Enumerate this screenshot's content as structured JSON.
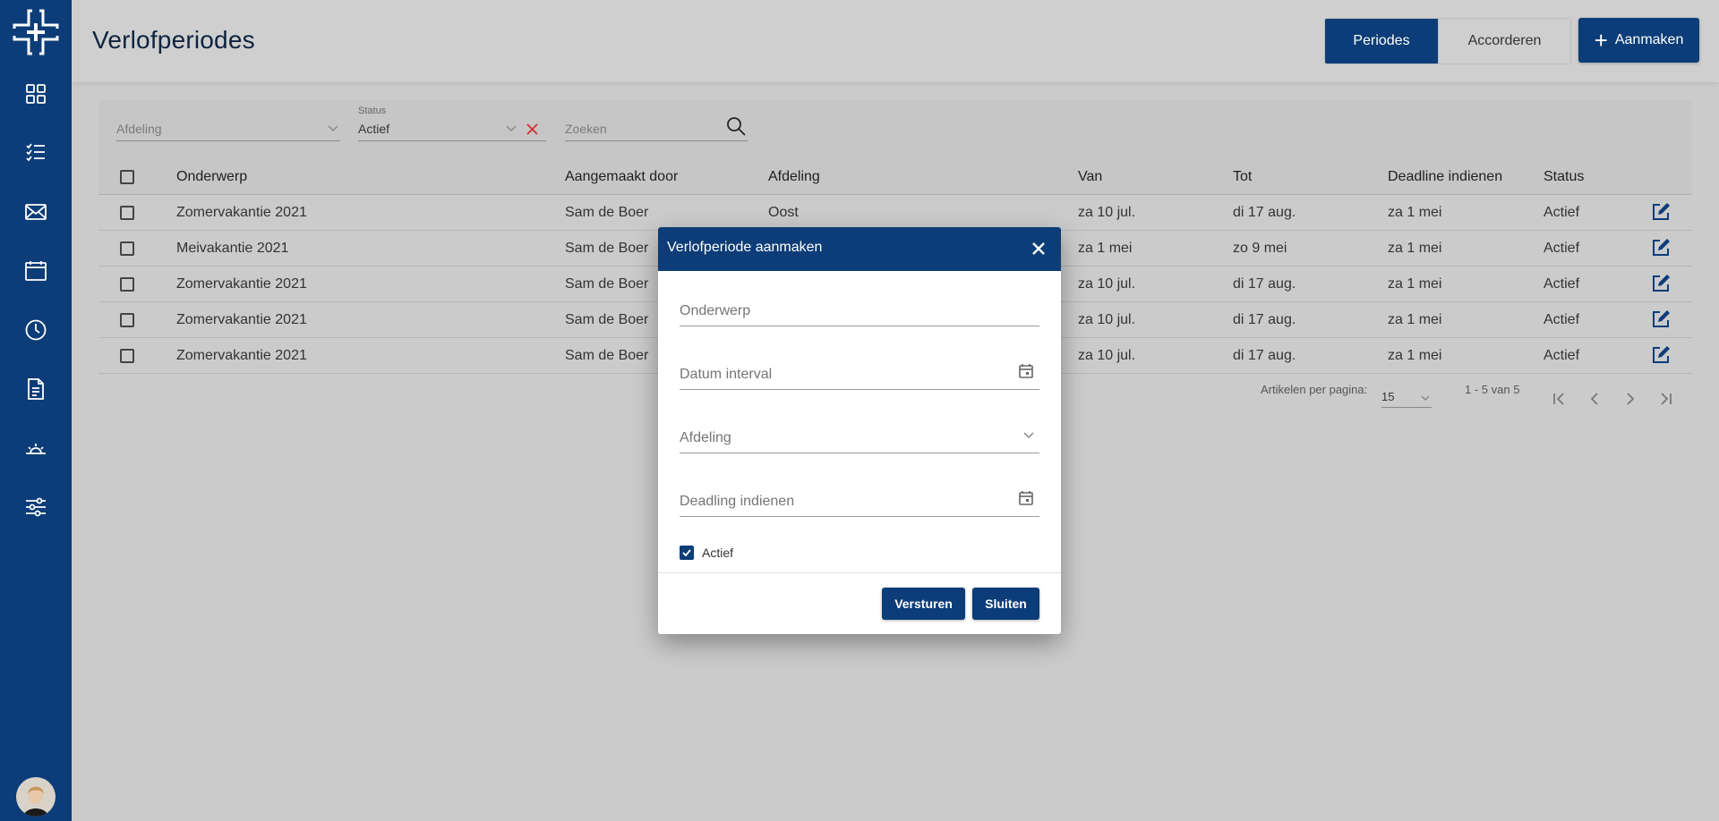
{
  "header": {
    "title": "Verlofperiodes",
    "tabs": [
      {
        "label": "Periodes",
        "active": true
      },
      {
        "label": "Accorderen",
        "active": false
      }
    ],
    "create_label": "Aanmaken"
  },
  "sidebar": {
    "items": [
      {
        "icon": "dashboard-grid-icon"
      },
      {
        "icon": "checklist-icon"
      },
      {
        "icon": "mail-icon"
      },
      {
        "icon": "calendar-icon"
      },
      {
        "icon": "clock-icon"
      },
      {
        "icon": "document-icon"
      },
      {
        "icon": "sunrise-icon"
      },
      {
        "icon": "sliders-icon"
      }
    ]
  },
  "filters": {
    "afdeling_placeholder": "Afdeling",
    "status_label": "Status",
    "status_value": "Actief",
    "search_placeholder": "Zoeken"
  },
  "table": {
    "columns": [
      "Onderwerp",
      "Aangemaakt door",
      "Afdeling",
      "Van",
      "Tot",
      "Deadline indienen",
      "Status"
    ],
    "rows": [
      {
        "onderwerp": "Zomervakantie 2021",
        "aangemaakt_door": "Sam de Boer",
        "afdeling": "Oost",
        "van": "za 10 jul.",
        "tot": "di 17 aug.",
        "deadline": "za 1 mei",
        "status": "Actief"
      },
      {
        "onderwerp": "Meivakantie 2021",
        "aangemaakt_door": "Sam de Boer",
        "afdeling": "",
        "van": "za 1 mei",
        "tot": "zo 9 mei",
        "deadline": "za 1 mei",
        "status": "Actief"
      },
      {
        "onderwerp": "Zomervakantie 2021",
        "aangemaakt_door": "Sam de Boer",
        "afdeling": "",
        "van": "za 10 jul.",
        "tot": "di 17 aug.",
        "deadline": "za 1 mei",
        "status": "Actief"
      },
      {
        "onderwerp": "Zomervakantie 2021",
        "aangemaakt_door": "Sam de Boer",
        "afdeling": "",
        "van": "za 10 jul.",
        "tot": "di 17 aug.",
        "deadline": "za 1 mei",
        "status": "Actief"
      },
      {
        "onderwerp": "Zomervakantie 2021",
        "aangemaakt_door": "Sam de Boer",
        "afdeling": "",
        "van": "za 10 jul.",
        "tot": "di 17 aug.",
        "deadline": "za 1 mei",
        "status": "Actief"
      }
    ]
  },
  "paginator": {
    "items_per_page_label": "Artikelen per pagina:",
    "page_size": "15",
    "range_label": "1 - 5 van 5"
  },
  "modal": {
    "title": "Verlofperiode aanmaken",
    "fields": {
      "onderwerp": "Onderwerp",
      "datum_interval": "Datum interval",
      "afdeling": "Afdeling",
      "deadline": "Deadling indienen"
    },
    "actief_label": "Actief",
    "actief_checked": true,
    "submit_label": "Versturen",
    "close_label": "Sluiten"
  },
  "colors": {
    "primary": "#0c3d78",
    "background": "#cbcbcb",
    "clear_red": "#d32f2f"
  }
}
